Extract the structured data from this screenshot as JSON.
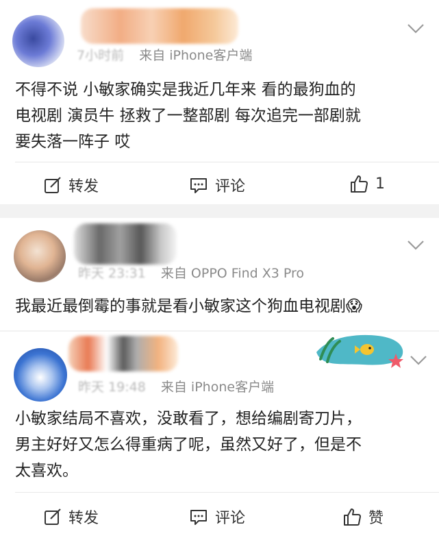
{
  "colors": {
    "page_bg": "#f2f2f2",
    "card_bg": "#ffffff",
    "meta_gray": "#8a8a8a",
    "text": "#222222"
  },
  "posts": [
    {
      "meta_time": "7小时前",
      "meta_source": "来自 iPhone客户端",
      "content": "不得不说 小敏家确实是我近几年来 看的最狗血的\n电视剧 演员牛 拯救了一整部剧 每次追完一部剧就\n要失落一阵子 哎",
      "actions": {
        "repost": "转发",
        "comment": "评论",
        "like": "1"
      }
    },
    {
      "meta_time": "昨天 23:31",
      "meta_source": "来自 OPPO Find X3 Pro",
      "content": "我最近最倒霉的事就是看小敏家这个狗血电视剧😱"
    },
    {
      "meta_time": "昨天 19:48",
      "meta_source": "来自 iPhone客户端",
      "content": "小敏家结局不喜欢，没敢看了，想给编剧寄刀片，\n男主好好又怎么得重病了呢，虽然又好了，但是不\n太喜欢。",
      "actions": {
        "repost": "转发",
        "comment": "评论",
        "like": "赞"
      }
    }
  ],
  "icons": {
    "repost": "edit-square-icon",
    "comment": "comment-bubble-icon",
    "like": "thumbs-up-icon",
    "menu": "chevron-down-icon"
  }
}
